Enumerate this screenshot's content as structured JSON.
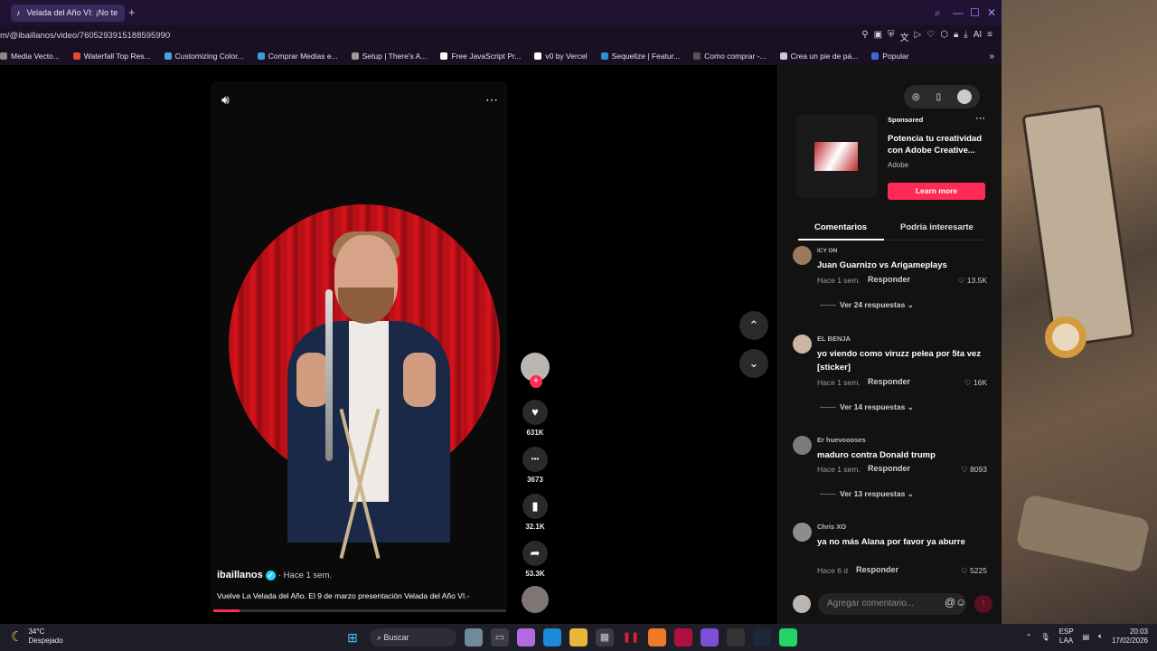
{
  "browser": {
    "tab_title": "Velada del Año VI: ¡No te",
    "tab_icon": "tiktok-icon",
    "url": "m/@ibaillanos/video/7605293915188595990",
    "ai_label": "AI",
    "bookmarks": [
      {
        "label": "Media Vecto...",
        "icon": "bookmark-icon",
        "color": "#888888"
      },
      {
        "label": "Waterfall Top Res...",
        "icon": "bookmark-icon",
        "color": "#e24a2a"
      },
      {
        "label": "Customizing Color...",
        "icon": "bookmark-icon",
        "color": "#4aa3df"
      },
      {
        "label": "Comprar Medias e...",
        "icon": "bookmark-icon",
        "color": "#3b9ae0"
      },
      {
        "label": "Setup | There's A...",
        "icon": "bookmark-icon",
        "color": "#9b9b9b"
      },
      {
        "label": "Free JavaScript Pr...",
        "icon": "bookmark-icon",
        "color": "#ffffff"
      },
      {
        "label": "v0 by Vercel",
        "icon": "bookmark-icon",
        "color": "#ffffff"
      },
      {
        "label": "Sequelize | Featur...",
        "icon": "bookmark-icon",
        "color": "#2f8fd6"
      },
      {
        "label": "Como comprar -...",
        "icon": "bookmark-icon",
        "color": "#555555"
      },
      {
        "label": "Crea un pie de pá...",
        "icon": "bookmark-icon",
        "color": "#cccccc"
      },
      {
        "label": "Popular",
        "icon": "bookmark-icon",
        "color": "#4466dd"
      }
    ]
  },
  "video": {
    "author": "ibaillanos",
    "posted": "· Hace 1 sem.",
    "description": "Vuelve La Velada del Año. El 9 de marzo presentación Velada del Año VI.-",
    "progress_fraction": 0.09,
    "actions": [
      {
        "icon": "heart-icon",
        "glyph": "♥",
        "count": "631K"
      },
      {
        "icon": "comment-icon",
        "glyph": "•••",
        "count": "3673"
      },
      {
        "icon": "bookmark-icon",
        "glyph": "▮",
        "count": "32.1K"
      },
      {
        "icon": "share-icon",
        "glyph": "➦",
        "count": "53.3K"
      }
    ]
  },
  "ad": {
    "sponsored": "Sponsored",
    "title": "Potencia tu creatividad con Adobe Creative...",
    "brand": "Adobe",
    "cta": "Learn more"
  },
  "panel": {
    "tab_comments": "Comentarios",
    "tab_interest": "Podría interesarte",
    "comment_placeholder": "Agregar comentario..."
  },
  "comments": [
    {
      "user": "ICY ON",
      "text": "Juan Guarnizo vs Arigameplays",
      "time": "Hace 1 sem.",
      "reply": "Responder",
      "likes": "13.5K",
      "replies": "Ver 24 respuestas"
    },
    {
      "user": "EL BENJA",
      "text": "yo viendo como viruzz pelea por 5ta vez [sticker]",
      "time": "Hace 1 sem.",
      "reply": "Responder",
      "likes": "16K",
      "replies": "Ver 14 respuestas"
    },
    {
      "user": "Er huevoooses",
      "text": "maduro contra Donald trump",
      "time": "Hace 1 sem.",
      "reply": "Responder",
      "likes": "8093",
      "replies": "Ver 13 respuestas"
    },
    {
      "user": "Chris XO",
      "text": "ya no más Alana por favor ya aburre",
      "time": "Hace 6 d",
      "reply": "Responder",
      "likes": "5225",
      "replies": ""
    }
  ],
  "taskbar": {
    "temp": "34°C",
    "weather": "Despejado",
    "search": "Buscar",
    "lang1": "ESP",
    "lang2": "LAA",
    "time": "20:03",
    "date": "17/02/2026"
  },
  "colors": {
    "accent": "#fe2c55",
    "tab_bar": "#1f1233"
  }
}
